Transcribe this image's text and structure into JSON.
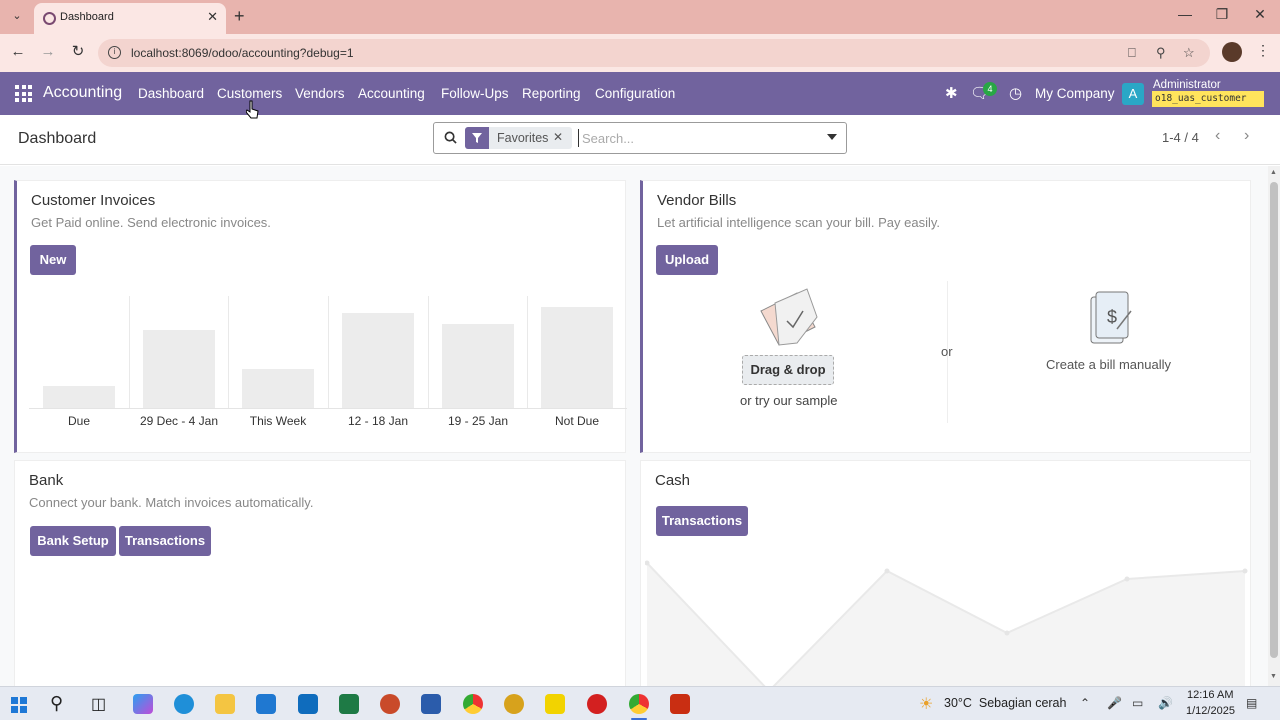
{
  "browser": {
    "tab_title": "Dashboard",
    "url": "localhost:8069/odoo/accounting?debug=1",
    "tab_menu_icon": "chevron-down-icon",
    "new_tab_icon": "plus-icon"
  },
  "navbar": {
    "brand": "Accounting",
    "menu": [
      "Dashboard",
      "Customers",
      "Vendors",
      "Accounting",
      "Follow-Ups",
      "Reporting",
      "Configuration"
    ],
    "chat_count": "4",
    "company": "My Company",
    "avatar_letter": "A",
    "user": "Administrator",
    "database": "o18_uas_customer"
  },
  "control": {
    "title": "Dashboard",
    "facet": "Favorites",
    "search_placeholder": "Search...",
    "pager": "1-4 / 4"
  },
  "customer_invoices": {
    "title": "Customer Invoices",
    "subtitle": "Get Paid online. Send electronic invoices.",
    "new_label": "New"
  },
  "chart_data": {
    "type": "bar",
    "categories": [
      "Due",
      "29 Dec - 4 Jan",
      "This Week",
      "12 - 18 Jan",
      "19 - 25 Jan",
      "Not Due"
    ],
    "values": [
      20,
      70,
      35,
      85,
      75,
      90
    ],
    "ylim": [
      0,
      100
    ],
    "grid": false
  },
  "vendor_bills": {
    "title": "Vendor Bills",
    "subtitle": "Let artificial intelligence scan your bill. Pay easily.",
    "upload_label": "Upload",
    "dragdrop_label": "Drag & drop",
    "try_sample": "or try our sample",
    "or_label": "or",
    "create_manual": "Create a bill manually"
  },
  "bank": {
    "title": "Bank",
    "subtitle": "Connect your bank. Match invoices automatically.",
    "setup_label": "Bank Setup",
    "transactions_label": "Transactions"
  },
  "cash": {
    "title": "Cash",
    "transactions_label": "Transactions"
  },
  "taskbar": {
    "weather_temp": "30°C",
    "weather_desc": "Sebagian cerah",
    "time": "12:16 AM",
    "date": "1/12/2025"
  },
  "colors": {
    "brand": "#71639e",
    "db_badge": "#ffe45c",
    "chat_badge": "#28a745"
  }
}
